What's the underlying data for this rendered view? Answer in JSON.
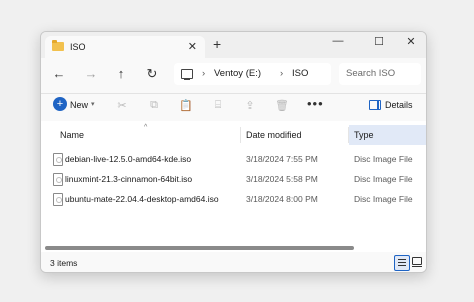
{
  "window": {
    "tab_title": "ISO",
    "tab_close": "✕",
    "new_tab": "+",
    "controls": {
      "minimize": "—",
      "maximize": "☐",
      "close": "✕"
    }
  },
  "nav": {
    "back": "←",
    "forward": "→",
    "up": "↑",
    "refresh": "↻",
    "breadcrumb": [
      "Ventoy (E:)",
      "ISO"
    ],
    "separator": "›",
    "search_placeholder": "Search ISO"
  },
  "commandbar": {
    "new_label": "New",
    "new_plus": "+",
    "new_dropdown": "▾",
    "icons": [
      "cut-icon",
      "copy-icon",
      "paste-icon",
      "rename-icon",
      "share-icon",
      "delete-icon"
    ],
    "icon_glyphs": [
      "✂",
      "⧉",
      "📋",
      "⌸",
      "⇪",
      "🗑"
    ],
    "more": "•••",
    "details_label": "Details"
  },
  "columns": {
    "name": "Name",
    "date": "Date modified",
    "type": "Type",
    "sort_indicator": "^"
  },
  "files": [
    {
      "name": "debian-live-12.5.0-amd64-kde.iso",
      "date": "3/18/2024 7:55 PM",
      "type": "Disc Image File"
    },
    {
      "name": "linuxmint-21.3-cinnamon-64bit.iso",
      "date": "3/18/2024 5:58 PM",
      "type": "Disc Image File"
    },
    {
      "name": "ubuntu-mate-22.04.4-desktop-amd64.iso",
      "date": "3/18/2024 8:00 PM",
      "type": "Disc Image File"
    }
  ],
  "status": {
    "item_count": "3 items"
  },
  "colors": {
    "accent": "#1f64c4",
    "selected_header": "#e1e9f7",
    "folder": "#f2c14e"
  }
}
